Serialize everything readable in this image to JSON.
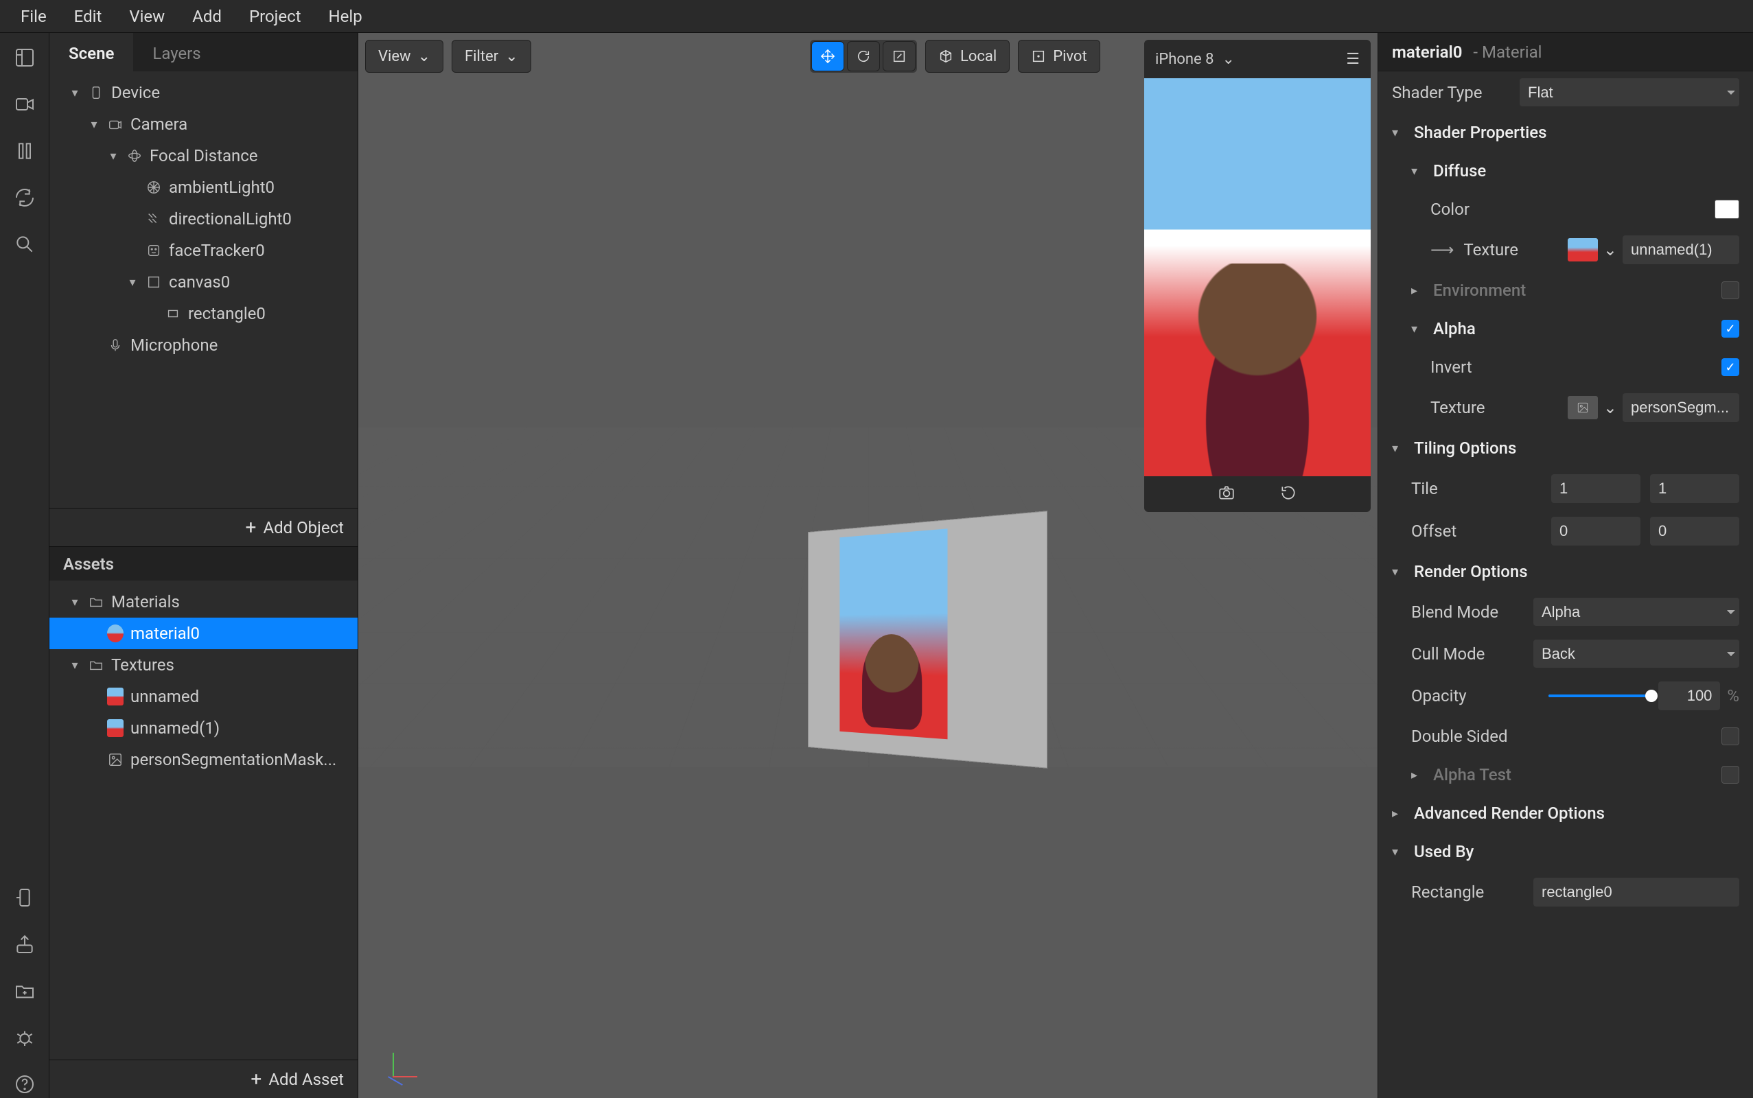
{
  "menubar": [
    "File",
    "Edit",
    "View",
    "Add",
    "Project",
    "Help"
  ],
  "scenePanel": {
    "tabs": {
      "scene": "Scene",
      "layers": "Layers"
    },
    "tree": [
      {
        "indent": 0,
        "arrow": "▾",
        "icon": "device",
        "label": "Device"
      },
      {
        "indent": 1,
        "arrow": "▾",
        "icon": "camera",
        "label": "Camera"
      },
      {
        "indent": 2,
        "arrow": "▾",
        "icon": "focal",
        "label": "Focal Distance"
      },
      {
        "indent": 3,
        "arrow": "",
        "icon": "ambient",
        "label": "ambientLight0"
      },
      {
        "indent": 3,
        "arrow": "",
        "icon": "directional",
        "label": "directionalLight0"
      },
      {
        "indent": 3,
        "arrow": "",
        "icon": "face",
        "label": "faceTracker0"
      },
      {
        "indent": 3,
        "arrow": "▾",
        "icon": "canvas",
        "label": "canvas0"
      },
      {
        "indent": 4,
        "arrow": "",
        "icon": "rect",
        "label": "rectangle0"
      },
      {
        "indent": 1,
        "arrow": "",
        "icon": "mic",
        "label": "Microphone"
      }
    ],
    "footer": "Add Object"
  },
  "assetsPanel": {
    "title": "Assets",
    "tree": [
      {
        "indent": 0,
        "arrow": "▾",
        "icon": "folder",
        "label": "Materials"
      },
      {
        "indent": 1,
        "arrow": "",
        "icon": "mat",
        "label": "material0",
        "selected": true
      },
      {
        "indent": 0,
        "arrow": "▾",
        "icon": "folder",
        "label": "Textures"
      },
      {
        "indent": 1,
        "arrow": "",
        "icon": "tex",
        "label": "unnamed"
      },
      {
        "indent": 1,
        "arrow": "",
        "icon": "tex",
        "label": "unnamed(1)"
      },
      {
        "indent": 1,
        "arrow": "",
        "icon": "seg",
        "label": "personSegmentationMask..."
      }
    ],
    "footer": "Add Asset"
  },
  "viewport": {
    "viewBtn": "View",
    "filterBtn": "Filter",
    "localBtn": "Local",
    "pivotBtn": "Pivot"
  },
  "devicePreview": {
    "device": "iPhone 8"
  },
  "inspector": {
    "name": "material0",
    "type": "- Material",
    "shaderTypeLabel": "Shader Type",
    "shaderType": "Flat",
    "sections": {
      "shaderProps": "Shader Properties",
      "diffuse": "Diffuse",
      "color": "Color",
      "textureLabel": "Texture",
      "textureValue": "unnamed(1)",
      "environment": "Environment",
      "alpha": "Alpha",
      "invert": "Invert",
      "alphaTexture": "Texture",
      "alphaTextureValue": "personSegm...",
      "tiling": "Tiling Options",
      "tile": "Tile",
      "tileX": "1",
      "tileY": "1",
      "offset": "Offset",
      "offsetX": "0",
      "offsetY": "0",
      "render": "Render Options",
      "blendMode": "Blend Mode",
      "blendModeValue": "Alpha",
      "cullMode": "Cull Mode",
      "cullModeValue": "Back",
      "opacity": "Opacity",
      "opacityValue": "100",
      "opacityUnit": "%",
      "doubleSided": "Double Sided",
      "alphaTest": "Alpha Test",
      "advanced": "Advanced Render Options",
      "usedBy": "Used By",
      "usedByLabel": "Rectangle",
      "usedByValue": "rectangle0"
    },
    "checks": {
      "environment": false,
      "alpha": true,
      "invert": true,
      "doubleSided": false,
      "alphaTest": false
    },
    "opacityPercent": 100
  }
}
